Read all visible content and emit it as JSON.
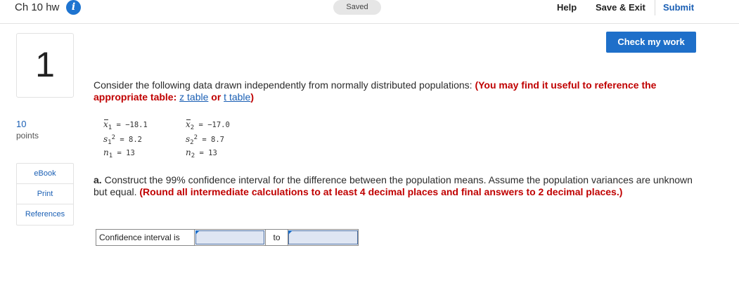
{
  "header": {
    "assignment_title": "Ch 10 hw",
    "info_icon": "info-icon",
    "saved_status": "Saved",
    "help_label": "Help",
    "save_exit_label": "Save & Exit",
    "submit_label": "Submit"
  },
  "toolbar": {
    "check_label": "Check my work"
  },
  "question": {
    "number": "1",
    "points_value": "10",
    "points_label": "points",
    "tools": [
      "eBook",
      "Print",
      "References"
    ],
    "prompt_text": "Consider the following data drawn independently from normally distributed populations: ",
    "prompt_hint_open": "(You may find it useful to reference the appropriate table: ",
    "z_table_link": "z table",
    "or_text": " or ",
    "t_table_link": "t table",
    "prompt_hint_close": ")",
    "data": {
      "x1_sym": "x",
      "x1_sub": "1",
      "x1_val": "−18.1",
      "x2_sym": "x",
      "x2_sub": "2",
      "x2_val": "−17.0",
      "s1_sym": "s",
      "s1_sub": "1",
      "s1_sup": "2",
      "s1_val": "8.2",
      "s2_sym": "s",
      "s2_sub": "2",
      "s2_sup": "2",
      "s2_val": "8.7",
      "n1_sym": "n",
      "n1_sub": "1",
      "n1_val": "13",
      "n2_sym": "n",
      "n2_sub": "2",
      "n2_val": "13",
      "equals": "="
    },
    "part_a_label": "a.",
    "part_a_text": " Construct the 99% confidence interval for the difference between the population means. Assume the population variances are unknown but equal. ",
    "part_a_instructions": "(Round all intermediate calculations to at least 4 decimal places and final answers to 2 decimal places.)",
    "answer": {
      "label": "Confidence interval is",
      "to_label": "to",
      "lower_value": "",
      "upper_value": ""
    }
  },
  "colors": {
    "accent_blue": "#1e6fc9",
    "link_blue": "#1a5fb4",
    "instruction_red": "#c00000"
  }
}
